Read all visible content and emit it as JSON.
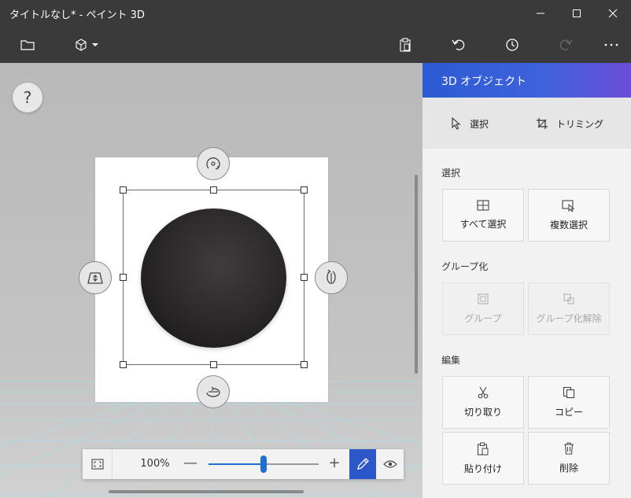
{
  "window": {
    "title": "タイトルなし* - ペイント 3D"
  },
  "toolbar": {
    "menu_icon": "folder-icon",
    "object_icon": "3d-cube-icon"
  },
  "canvas": {
    "help_label": "?"
  },
  "zoom": {
    "percent_label": "100%",
    "minus_label": "—",
    "plus_label": "+",
    "level_fraction": 0.5
  },
  "panel": {
    "title": "3D オブジェクト",
    "mode_select": "選択",
    "mode_crop": "トリミング",
    "sections": {
      "select": "選択",
      "group": "グループ化",
      "edit": "編集"
    },
    "buttons": {
      "select_all": "すべて選択",
      "multi_select": "複数選択",
      "group": "グループ",
      "ungroup": "グループ化解除",
      "cut": "切り取り",
      "copy": "コピー",
      "paste": "貼り付け",
      "delete": "削除"
    }
  },
  "colors": {
    "accent": "#2b57c8",
    "panel_head_start": "#2c5bd3",
    "panel_head_end": "#6a4fd8"
  }
}
